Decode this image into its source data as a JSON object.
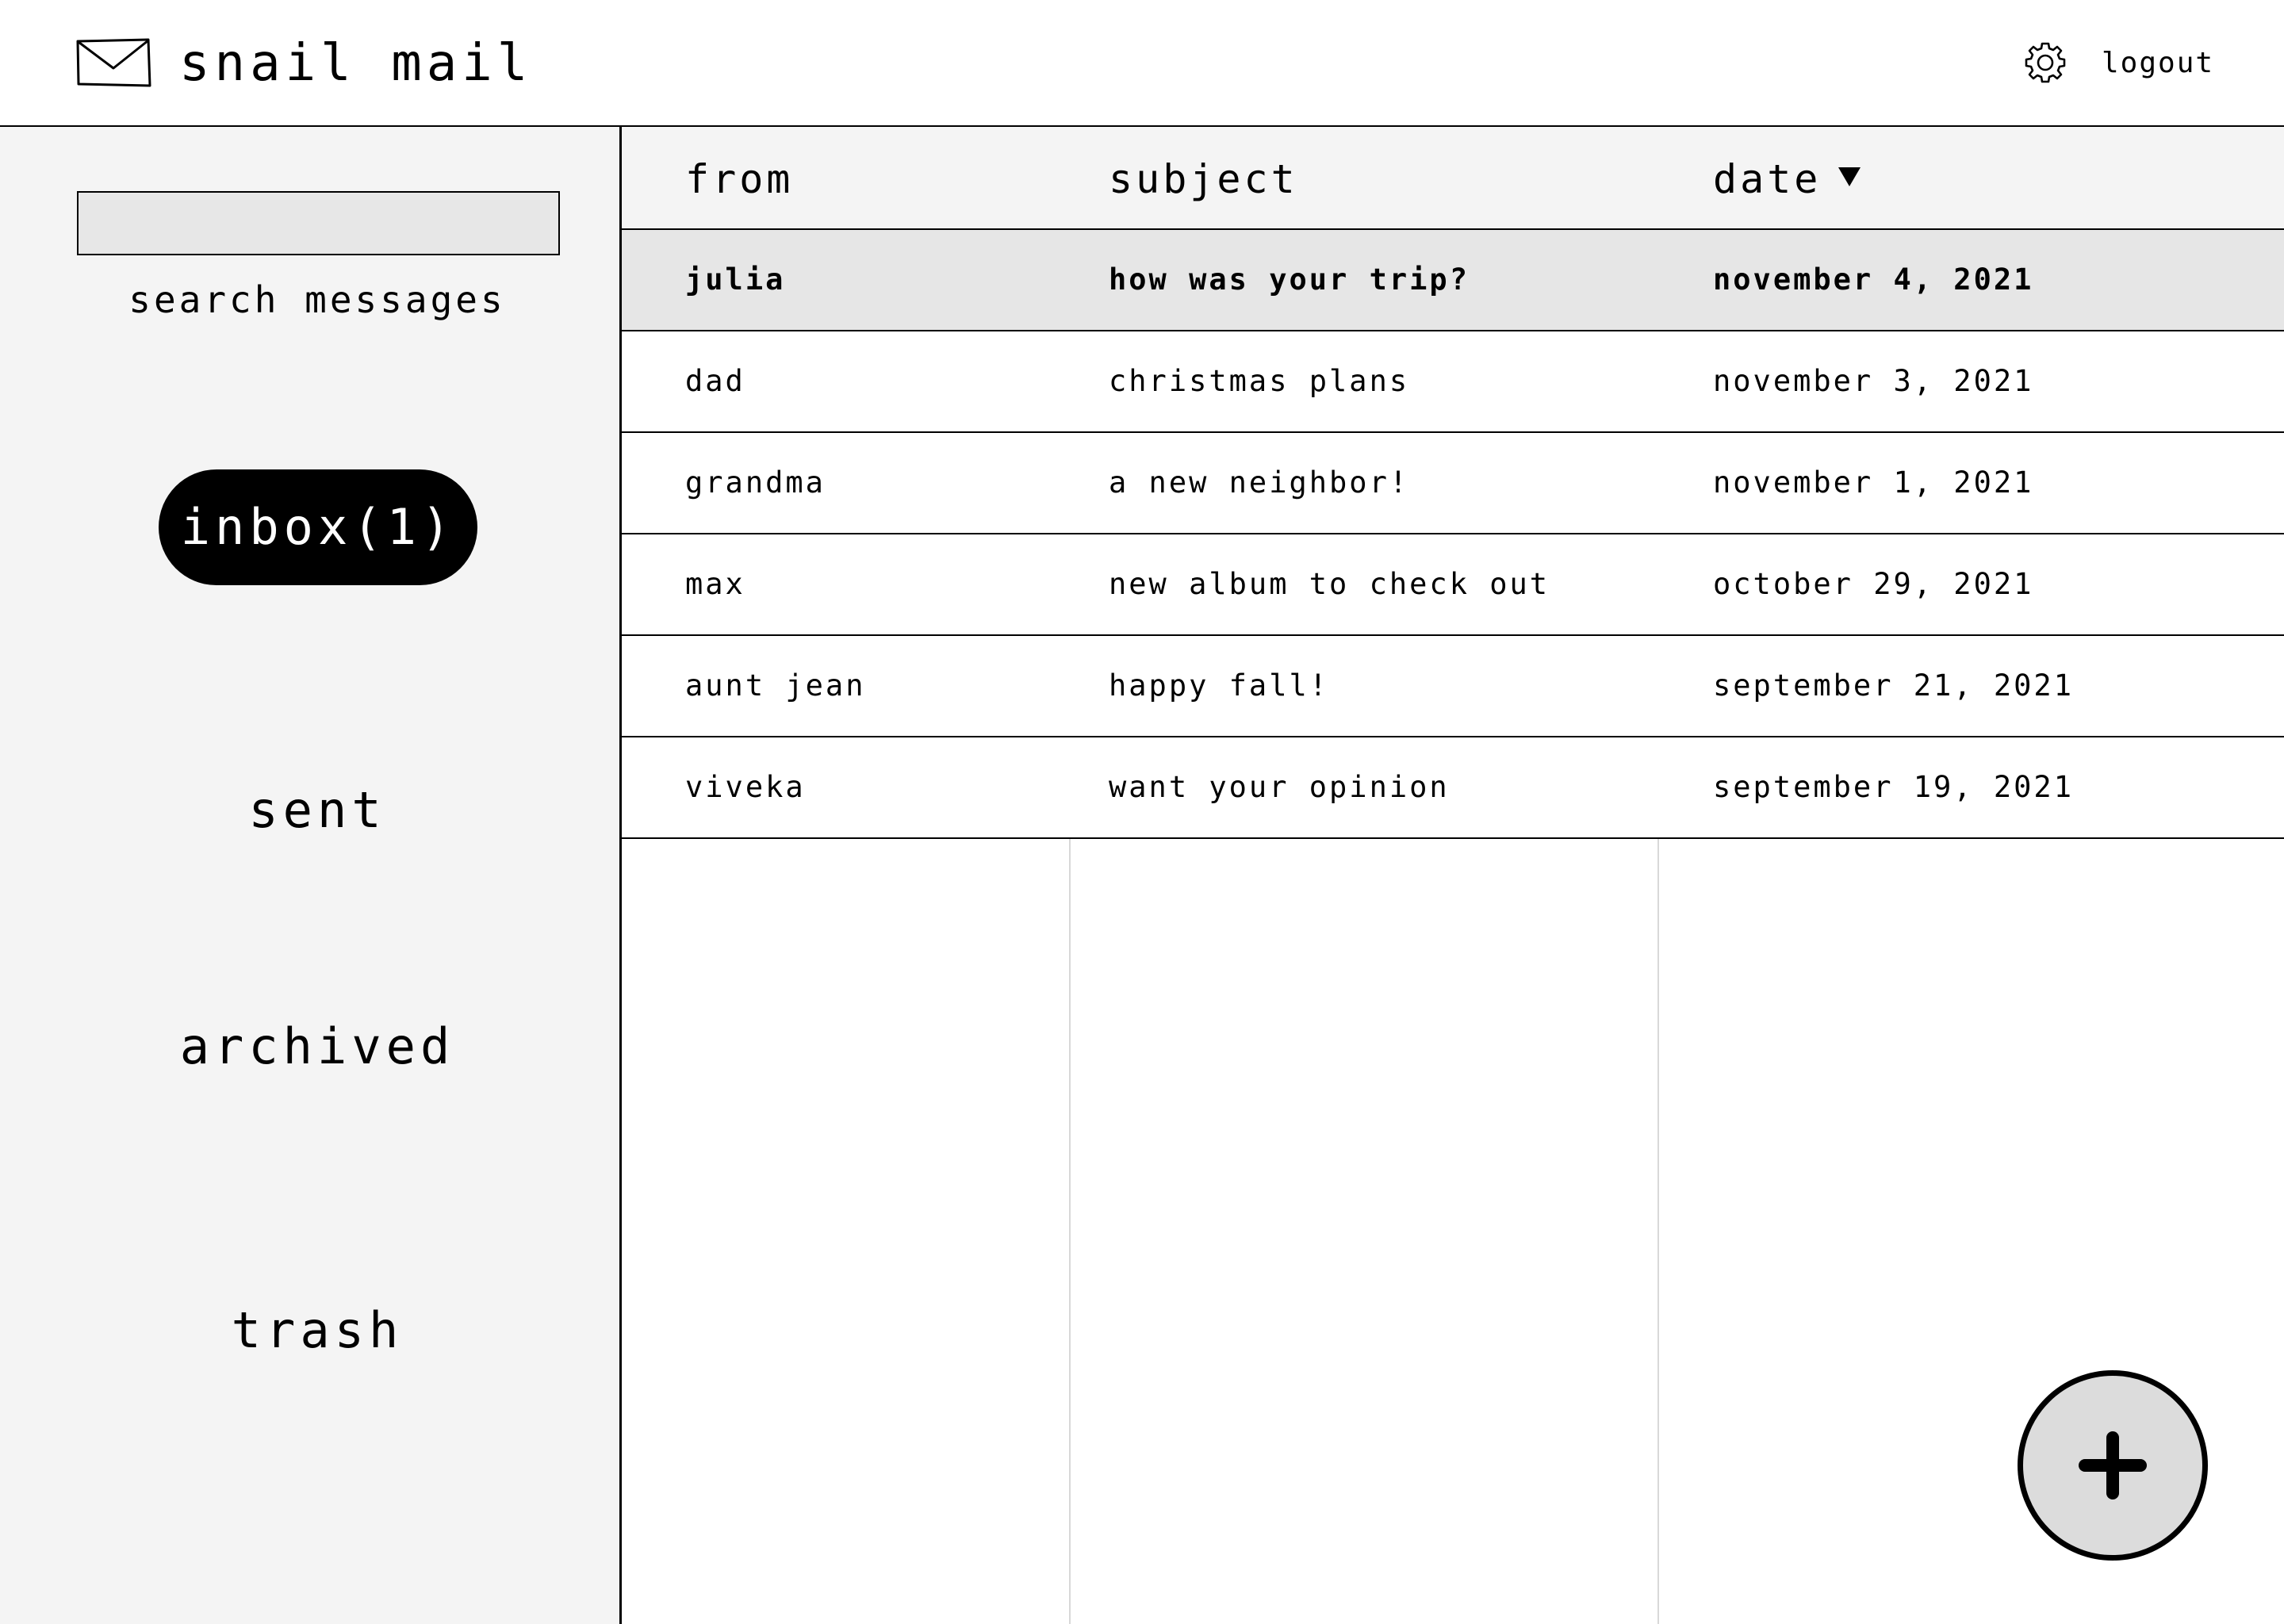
{
  "header": {
    "app_title": "snail mail",
    "logout_label": "logout",
    "logo_icon": "envelope-icon",
    "settings_icon": "gear-icon"
  },
  "sidebar": {
    "search": {
      "value": "",
      "label": "search messages"
    },
    "nav": [
      {
        "label": "inbox(1)",
        "active": true
      },
      {
        "label": "sent",
        "active": false
      },
      {
        "label": "archived",
        "active": false
      },
      {
        "label": "trash",
        "active": false
      }
    ]
  },
  "table": {
    "columns": [
      {
        "label": "from"
      },
      {
        "label": "subject"
      },
      {
        "label": "date",
        "sorted": "descending"
      }
    ],
    "rows": [
      {
        "from": "julia",
        "subject": "how was your trip?",
        "date": "november 4, 2021",
        "selected": true
      },
      {
        "from": "dad",
        "subject": "christmas plans",
        "date": "november 3, 2021",
        "selected": false
      },
      {
        "from": "grandma",
        "subject": "a new neighbor!",
        "date": "november 1, 2021",
        "selected": false
      },
      {
        "from": "max",
        "subject": "new album to check out",
        "date": "october 29, 2021",
        "selected": false
      },
      {
        "from": "aunt jean",
        "subject": "happy fall!",
        "date": "september 21, 2021",
        "selected": false
      },
      {
        "from": "viveka",
        "subject": "want your opinion",
        "date": "september 19, 2021",
        "selected": false
      }
    ]
  },
  "compose": {
    "icon": "plus-icon"
  },
  "colors": {
    "accent": "#000000",
    "sidebar_bg": "#f4f4f4",
    "selected_row_bg": "#e6e6e6",
    "fab_bg": "#dcdcdc"
  }
}
